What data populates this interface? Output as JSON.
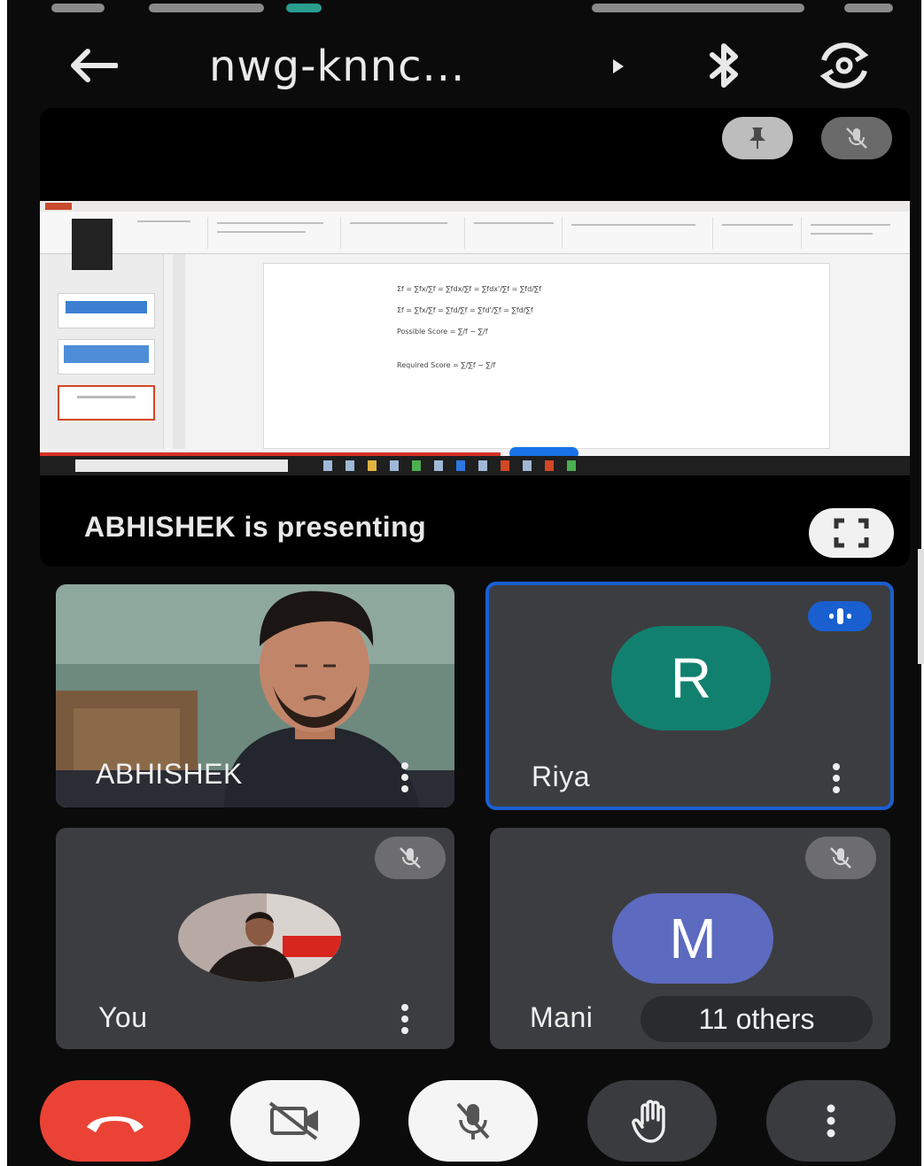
{
  "header": {
    "meeting_code": "nwg-knnc..."
  },
  "presentation": {
    "label": "ABHISHEK is presenting",
    "slide_lines": [
      "Σf = ∑fx/∑f = ∑fdx/∑f = ∑fdx'/∑f = ∑fd/∑f",
      "Σf = ∑fx/∑f = ∑fd/∑f = ∑fd'/∑f = ∑fd/∑f",
      "Possible Score = ∑/f − ∑/f",
      "Required Score = ∑/∑f − ∑/f"
    ]
  },
  "participants": [
    {
      "name": "ABHISHEK",
      "type": "video"
    },
    {
      "name": "Riya",
      "initial": "R",
      "avatar_color": "#12806f",
      "speaking": true
    },
    {
      "name": "You",
      "type": "photo",
      "muted": true
    },
    {
      "name": "Mani",
      "initial": "M",
      "avatar_color": "#5c6bc0",
      "muted": true
    }
  ],
  "others": "11 others",
  "colors": {
    "end_call": "#ea4335",
    "active_speaker": "#1a5fd0",
    "tile_bg": "#3c3d40",
    "background": "#0b0b0c"
  }
}
